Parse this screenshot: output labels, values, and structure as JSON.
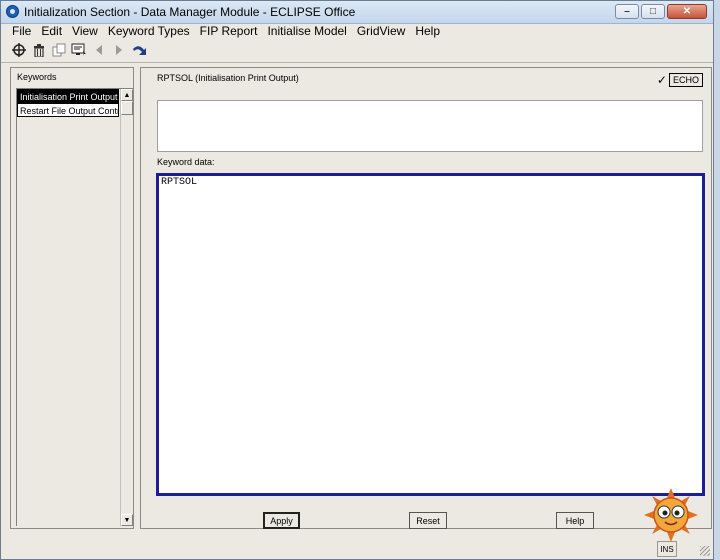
{
  "window": {
    "title": "Initialization Section - Data Manager Module - ECLIPSE Office"
  },
  "menu": [
    "File",
    "Edit",
    "View",
    "Keyword Types",
    "FIP Report",
    "Initialise Model",
    "GridView",
    "Help"
  ],
  "toolbar_icons": [
    "crosshair-icon",
    "trash-icon",
    "copy-icon",
    "screen-icon",
    "back-arrow-icon",
    "forward-arrow-icon",
    "undo-arrow-icon"
  ],
  "left_panel": {
    "label": "Keywords",
    "items": [
      "Initialisation Print Output",
      "Restart File Output Control"
    ]
  },
  "right_panel": {
    "keyword_title": "RPTSOL (Initialisation Print Output)",
    "echo_label": "ECHO",
    "echo_checked": true,
    "description": "",
    "keyword_data_label": "Keyword data:",
    "keyword_data": "RPTSOL"
  },
  "buttons": {
    "apply": "Apply",
    "reset": "Reset",
    "help": "Help"
  },
  "status": {
    "ins": "INS"
  },
  "colors": {
    "titlebar": "#c3d6ec",
    "selection": "#000000",
    "data_border": "#1d1d94"
  }
}
